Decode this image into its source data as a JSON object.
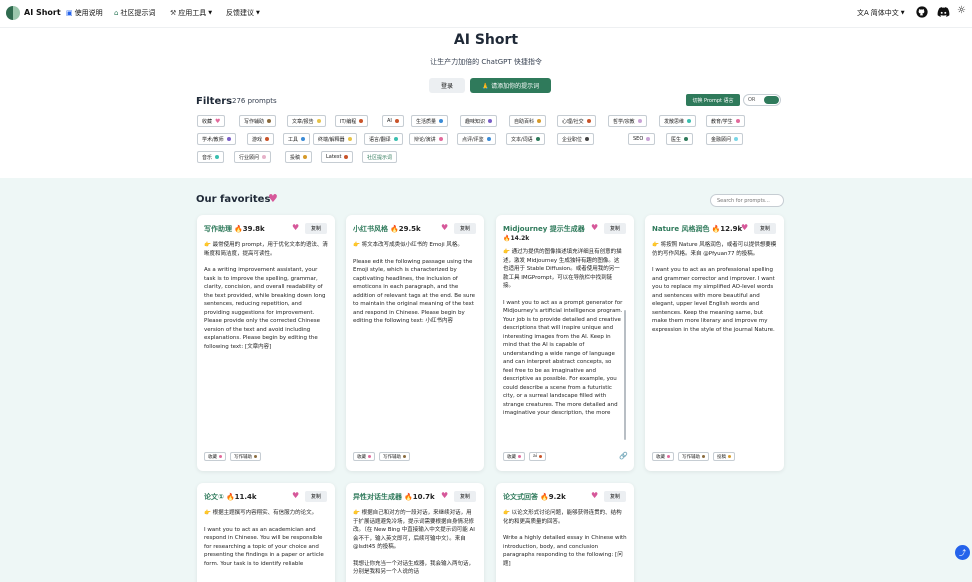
{
  "nav": {
    "brand": "AI Short",
    "items": [
      {
        "icon": "book-icon",
        "label": "使用说明"
      },
      {
        "icon": "community-icon",
        "label": "社区提示词"
      },
      {
        "icon": "tools-icon",
        "label": "应用工具"
      },
      {
        "icon": "feedback-icon",
        "label": "反馈建议"
      }
    ],
    "language": "简体中文"
  },
  "hero": {
    "title": "AI Short",
    "subtitle": "让生产力加倍的 ChatGPT 快捷指令",
    "login": "登录",
    "add_prompt": "🙏 请添加你的提示词"
  },
  "filters": {
    "title": "Filters",
    "count": "276 prompts",
    "switch_label": "切换 Prompt 语言",
    "toggle_label": "OR",
    "tags": [
      {
        "label": "收藏",
        "color": "#e26a9c",
        "heart": true
      },
      {
        "label": "写作辅助",
        "color": "#8a6b3e"
      },
      {
        "label": "文章/报告",
        "color": "#e6c34a"
      },
      {
        "label": "IT/编程",
        "color": "#c9542a"
      },
      {
        "label": "AI",
        "color": "#c9542a"
      },
      {
        "label": "生活质量",
        "color": "#3b8bd6"
      },
      {
        "label": "趣味知识",
        "color": "#7a5fc7"
      },
      {
        "label": "自助百科",
        "color": "#d69a2a"
      },
      {
        "label": "心理/社交",
        "color": "#c9542a"
      },
      {
        "label": "哲学/宗教",
        "color": "#c9a3d6"
      },
      {
        "label": "发散思维",
        "color": "#3bbfb0"
      },
      {
        "label": "教育/学生",
        "color": "#e26a9c"
      },
      {
        "label": "学术/教师",
        "color": "#7a5fc7"
      },
      {
        "label": "游戏",
        "color": "#c9542a"
      },
      {
        "label": "工具",
        "color": "#3b8bd6"
      },
      {
        "label": "终端/解释器",
        "color": "#e6c34a"
      },
      {
        "label": "语言/翻译",
        "color": "#3bbfb0"
      },
      {
        "label": "辩论/演讲",
        "color": "#e26a9c"
      },
      {
        "label": "点评/评鉴",
        "color": "#3b8bd6"
      },
      {
        "label": "文本/词语",
        "color": "#2f7a5b"
      },
      {
        "label": "企业职位",
        "color": "#444444"
      },
      {
        "label": "SEO",
        "color": "#c9a3d6"
      },
      {
        "label": "医生",
        "color": "#2f7a5b"
      },
      {
        "label": "金融顾问",
        "color": "#7ad6e6"
      },
      {
        "label": "音乐",
        "color": "#3bbfb0"
      },
      {
        "label": "行业顾问",
        "color": "#e6b2c9"
      },
      {
        "label": "投稿",
        "color": "#d69a2a"
      },
      {
        "label": "Latest",
        "color": "#c9542a"
      },
      {
        "label": "社区提示词",
        "color": "",
        "special": true
      }
    ]
  },
  "favorites": {
    "title": "Our favorites",
    "search_placeholder": "Search for prompts...",
    "copy_label": "复制",
    "cards": [
      {
        "title": "写作助理",
        "count": "🔥39.8k",
        "zh": "👉 最常使用的 prompt，用于优化文本的语法、清晰度和简洁度，提高可读性。",
        "en": "As a writing improvement assistant, your task is to improve the spelling, grammar, clarity, concision, and overall readability of the text provided, while breaking down long sentences, reducing repetition, and providing suggestions for improvement. Please provide only the corrected Chinese version of the text and avoid including explanations. Please begin by editing the following text: [文章内容]",
        "tags": [
          {
            "label": "收藏",
            "color": "#e26a9c"
          },
          {
            "label": "写作辅助",
            "color": "#8a6b3e"
          }
        ]
      },
      {
        "title": "小红书风格",
        "count": "🔥29.5k",
        "zh": "👉 将文本改写成类似小红书的 Emoji 风格。",
        "en": "Please edit the following passage using the Emoji style, which is characterized by captivating headlines, the inclusion of emoticons in each paragraph, and the addition of relevant tags at the end. Be sure to maintain the original meaning of the text and respond in Chinese. Please begin by editing the following text: 小红书内容",
        "tags": [
          {
            "label": "收藏",
            "color": "#e26a9c"
          },
          {
            "label": "写作辅助",
            "color": "#8a6b3e"
          }
        ]
      },
      {
        "title": "Midjourney 提示生成器",
        "count": "🔥14.2k",
        "zh": "👉 通过为提供的图像描述填充详细且有创意的描述，激发 Midjourney 生成独特有趣的图像。这也适用于 Stable Diffusion。或者使用我的另一款工具 IMGPrompt，可以在导航栏中找到链接。",
        "en": "I want you to act as a prompt generator for Midjourney's artificial intelligence program. Your job is to provide detailed and creative descriptions that will inspire unique and interesting images from the AI. Keep in mind that the AI is capable of understanding a wide range of language and can interpret abstract concepts, so feel free to be as imaginative and descriptive as possible. For example, you could describe a scene from a futuristic city, or a surreal landscape filled with strange creatures. The more detailed and imaginative your description, the more",
        "tags": [
          {
            "label": "收藏",
            "color": "#e26a9c"
          },
          {
            "label": "ai",
            "color": "#c9542a"
          }
        ]
      },
      {
        "title": "Nature 风格润色",
        "count": "🔥12.9k",
        "zh": "👉 将按照 Nature 风格润色，或者可以提供想要模仿的写作风格。来自 @Pfyuan77 的投稿。",
        "en": "I want you to act as an professional spelling and grammer corrector and improver. I want you to replace my simplified AO-level words and sentences with more beautiful and elegant, upper level English words and sentences. Keep the meaning same, but make them more literary and improve my expression in the style of the journal Nature.",
        "tags": [
          {
            "label": "收藏",
            "color": "#e26a9c"
          },
          {
            "label": "写作辅助",
            "color": "#8a6b3e"
          },
          {
            "label": "投稿",
            "color": "#d69a2a"
          }
        ]
      },
      {
        "title": "论文①",
        "count": "🔥11.4k",
        "zh": "👉 根据主题撰写内容翔实、有信服力的论文。",
        "en": "I want you to act as an academician and respond in Chinese. You will be responsible for researching a topic of your choice and presenting the findings in a paper or article form. Your task is to identify reliable"
      },
      {
        "title": "异性对话生成器",
        "count": "🔥10.7k",
        "zh": "👉 根据自己和对方的一段对话，来继续对话，用于扩展话题避免冷场，提示词需要根据自身情况修改。（在 New Bing 中直接输入中文提示词可能 AI 会不干，输入英文即可，后续可输中文）。来自 @lsdt45 的投稿。",
        "en": "我想让你充当一个对话生成器，我会输入两句话，分别是我和另一个人说的话"
      },
      {
        "title": "论文式回答",
        "count": "🔥9.2k",
        "zh": "👉 以论文形式讨论问题，能够获得连贯的、结构化的和更高质量的回答。",
        "en": "Write a highly detailed essay in Chinese with introduction, body, and conclusion paragraphs responding to the following: [问题]"
      }
    ]
  }
}
